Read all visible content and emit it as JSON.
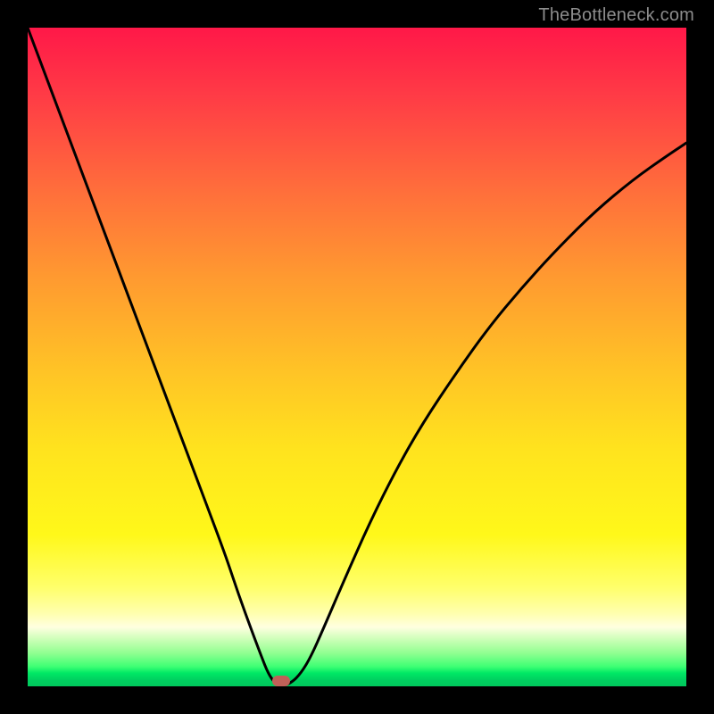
{
  "watermark": "TheBottleneck.com",
  "marker": {
    "x_fraction": 0.385,
    "color": "#c06058"
  },
  "chart_data": {
    "type": "line",
    "title": "",
    "xlabel": "",
    "ylabel": "",
    "xlim": [
      0,
      1
    ],
    "ylim": [
      0,
      1
    ],
    "series": [
      {
        "name": "curve",
        "x": [
          0.0,
          0.03,
          0.06,
          0.09,
          0.12,
          0.15,
          0.18,
          0.21,
          0.24,
          0.27,
          0.3,
          0.32,
          0.34,
          0.355,
          0.365,
          0.375,
          0.385,
          0.4,
          0.415,
          0.43,
          0.45,
          0.48,
          0.52,
          0.56,
          0.6,
          0.65,
          0.7,
          0.75,
          0.8,
          0.86,
          0.92,
          0.97,
          1.0
        ],
        "y": [
          1.0,
          0.92,
          0.84,
          0.76,
          0.68,
          0.6,
          0.52,
          0.44,
          0.36,
          0.28,
          0.2,
          0.14,
          0.085,
          0.045,
          0.02,
          0.005,
          0.0,
          0.005,
          0.02,
          0.045,
          0.09,
          0.16,
          0.25,
          0.33,
          0.4,
          0.475,
          0.545,
          0.605,
          0.66,
          0.72,
          0.77,
          0.805,
          0.825
        ]
      }
    ],
    "marker_point": {
      "x": 0.385,
      "y": 0.0
    }
  }
}
